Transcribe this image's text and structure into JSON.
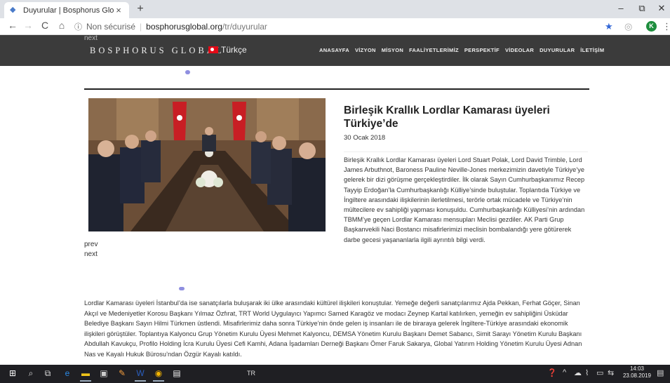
{
  "browser": {
    "tab_title": "Duyurular | Bosphorus Global",
    "tab_close": "×",
    "new_tab": "+",
    "win_min": "–",
    "win_max": "⧉",
    "win_close": "✕",
    "back": "←",
    "forward": "→",
    "reload": "C",
    "home": "⌂",
    "info_icon": "ⓘ",
    "security_label": "Non sécurisé",
    "url_host": "bosphorusglobal.org",
    "url_path": "/tr/duyurular",
    "star": "★",
    "profile_initial": "K",
    "menu": "⋮"
  },
  "site": {
    "hidden_next": "next",
    "brand": "BOSPHORUS GLOBAL",
    "language": "Türkçe",
    "nav": [
      "ANASAYFA",
      "VİZYON",
      "MİSYON",
      "FAALİYETLERİMİZ",
      "PERSPEKTİF",
      "VİDEOLAR",
      "DUYURULAR",
      "İLETİŞİM"
    ]
  },
  "article": {
    "title": "Birleşik Krallık Lordlar Kamarası üyeleri Türkiye’de",
    "date": "30 Ocak 2018",
    "summary": "Birleşik Krallık Lordlar Kamarası üyeleri Lord Stuart Polak, Lord David Trimble, Lord James Arbuthnot, Baroness Pauline Neville-Jones merkezimizin davetiyle Türkiye’ye gelerek bir dizi görüşme gerçekleştirdiler. İlk olarak Sayın Cumhurbaşkanımız Recep Tayyip Erdoğan’la Cumhurbaşkanlığı Külliye’sinde buluştular. Toplantıda Türkiye ve İngiltere arasındaki ilişkilerinin ilerletilmesi, terörle ortak mücadele ve Türkiye’nin mültecilere ev sahipliği yapması konuşuldu. Cumhurbaşkanlığı Külliyesi’nin ardından TBMM’ye geçen Lordlar Kamarası mensupları Meclisi gezdiler. AK Parti Grup Başkanvekili Naci Bostancı misafirlerimizi meclisin bombalandığı yere götürerek darbe gecesi yaşananlarla ilgili ayrıntılı bilgi verdi.",
    "prev": "prev",
    "next": "next",
    "body": "Lordlar Kamarası üyeleri İstanbul’da ise sanatçılarla buluşarak iki ülke arasındaki kültürel ilişkileri konuştular. Yemeğe değerli sanatçılarımız Ajda Pekkan, Ferhat Göçer, Sinan Akçıl ve Medeniyetler Korosu Başkanı Yılmaz Özfırat, TRT World Uygulayıcı Yapımcı Samed Karagöz ve modacı Zeynep Kartal katılırken, yemeğin ev sahipliğini Üsküdar Belediye Başkanı Sayın Hilmi Türkmen üstlendi. Misafirlerimiz daha sonra Türkiye’nin önde gelen iş insanları ile de biraraya gelerek İngiltere-Türkiye arasındaki ekonomik ilişkileri görüştüler. Toplantıya Kalyoncu Grup Yönetim Kurulu Üyesi Mehmet Kalyoncu, DEMSA Yönetim Kurulu Başkanı Demet Sabancı, Simit Sarayı Yönetim Kurulu Başkanı Abdullah Kavukçu, Profilo Holding İcra Kurulu Üyesi Cefi Kamhi, Adana İşadamları Derneği Başkanı Ömer Faruk Sakarya, Global Yatırım Holding Yönetim Kurulu Üyesi Adnan Nas ve Kayalı Hukuk Bürosu’ndan Özgür Kayalı katıldı."
  },
  "taskbar": {
    "lang": "TR",
    "time": "14:03",
    "date": "23.08.2019"
  },
  "colors": {
    "header_bg": "#3b3b3b",
    "accent": "#8f8fe0",
    "flag_red": "#e30a17"
  }
}
